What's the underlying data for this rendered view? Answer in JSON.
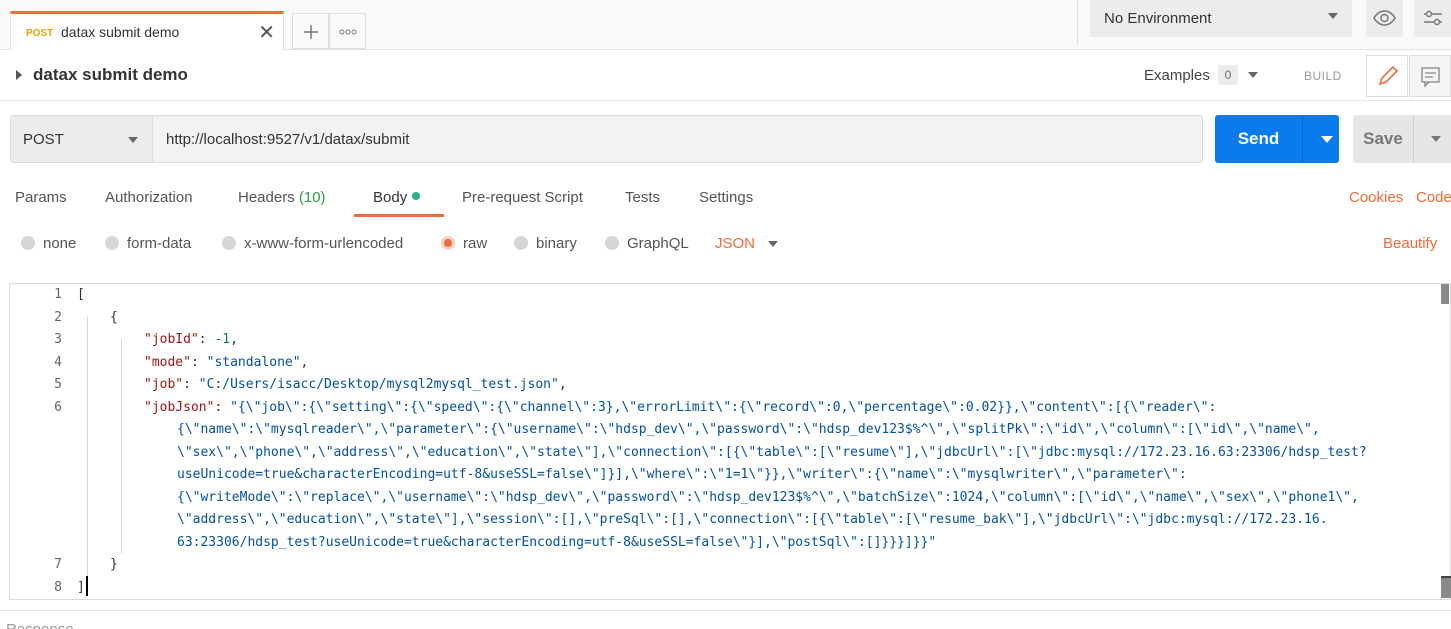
{
  "tabs": {
    "active_tab": {
      "method": "POST",
      "title": "datax submit demo"
    },
    "new_tab_icon": "plus-icon",
    "more_icon": "ellipsis-icon"
  },
  "environment": {
    "label": "No Environment"
  },
  "request": {
    "name": "datax submit demo",
    "examples_label": "Examples",
    "examples_count": "0",
    "build_label": "BUILD"
  },
  "url_bar": {
    "method": "POST",
    "url": "http://localhost:9527/v1/datax/submit",
    "send_label": "Send",
    "save_label": "Save"
  },
  "request_tabs": {
    "params": "Params",
    "authorization": "Authorization",
    "headers": "Headers",
    "headers_count": "(10)",
    "body": "Body",
    "pre_request": "Pre-request Script",
    "tests": "Tests",
    "settings": "Settings",
    "cookies": "Cookies",
    "code": "Code"
  },
  "body_types": {
    "none": "none",
    "form_data": "form-data",
    "urlencoded": "x-www-form-urlencoded",
    "raw": "raw",
    "binary": "binary",
    "graphql": "GraphQL",
    "format": "JSON",
    "beautify": "Beautify"
  },
  "editor": {
    "line_numbers": [
      "1",
      "2",
      "3",
      "4",
      "5",
      "6",
      "7",
      "8"
    ],
    "lines": {
      "l1": "[",
      "l2": "{",
      "l3_key": "\"jobId\"",
      "l3_val": "-1",
      "l4_key": "\"mode\"",
      "l4_val": "\"standalone\"",
      "l5_key": "\"job\"",
      "l5_val": "\"C:/Users/isacc/Desktop/mysql2mysql_test.json\"",
      "l6_key": "\"jobJson\"",
      "l6_w1": "\"{\\\"job\\\":{\\\"setting\\\":{\\\"speed\\\":{\\\"channel\\\":3},\\\"errorLimit\\\":{\\\"record\\\":0,\\\"percentage\\\":0.02}},\\\"content\\\":[{\\\"reader\\\":",
      "l6_w2": "{\\\"name\\\":\\\"mysqlreader\\\",\\\"parameter\\\":{\\\"username\\\":\\\"hdsp_dev\\\",\\\"password\\\":\\\"hdsp_dev123$%^\\\",\\\"splitPk\\\":\\\"id\\\",\\\"column\\\":[\\\"id\\\",\\\"name\\\",",
      "l6_w3": "\\\"sex\\\",\\\"phone\\\",\\\"address\\\",\\\"education\\\",\\\"state\\\"],\\\"connection\\\":[{\\\"table\\\":[\\\"resume\\\"],\\\"jdbcUrl\\\":[\\\"jdbc:mysql://172.23.16.63:23306/hdsp_test?",
      "l6_w4": "useUnicode=true&characterEncoding=utf-8&useSSL=false\\\"]}],\\\"where\\\":\\\"1=1\\\"}},\\\"writer\\\":{\\\"name\\\":\\\"mysqlwriter\\\",\\\"parameter\\\":",
      "l6_w5": "{\\\"writeMode\\\":\\\"replace\\\",\\\"username\\\":\\\"hdsp_dev\\\",\\\"password\\\":\\\"hdsp_dev123$%^\\\",\\\"batchSize\\\":1024,\\\"column\\\":[\\\"id\\\",\\\"name\\\",\\\"sex\\\",\\\"phone1\\\",",
      "l6_w6": "\\\"address\\\",\\\"education\\\",\\\"state\\\"],\\\"session\\\":[],\\\"preSql\\\":[],\\\"connection\\\":[{\\\"table\\\":[\\\"resume_bak\\\"],\\\"jdbcUrl\\\":\\\"jdbc:mysql://172.23.16.",
      "l6_w7": "63:23306/hdsp_test?useUnicode=true&characterEncoding=utf-8&useSSL=false\\\"}],\\\"postSql\\\":[]}}}]}}\"",
      "l7": "}",
      "l8": "]"
    }
  },
  "response": {
    "label": "Response"
  },
  "colors": {
    "accent": "#f26b3a",
    "send_blue": "#097bed",
    "method_post": "#e8a10c"
  }
}
